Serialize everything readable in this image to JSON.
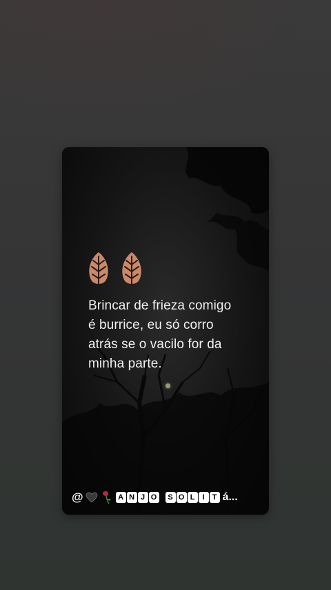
{
  "quote": {
    "text": "Brincar de frieza comigo\né burrice, eu só corro\natrás se o vacilo for da\nminha parte."
  },
  "caption": {
    "prefix": "@",
    "word1_letters": [
      "A",
      "N",
      "J",
      "O"
    ],
    "word2_letters": [
      "S",
      "O",
      "L",
      "I",
      "T"
    ],
    "suffix": "á..."
  },
  "icons": {
    "quote_marks": "leaf-icon",
    "heart": "black-heart-icon",
    "rose": "wilted-rose-icon"
  },
  "colors": {
    "leaf": "#c9896a",
    "text": "#f1f1f1"
  }
}
